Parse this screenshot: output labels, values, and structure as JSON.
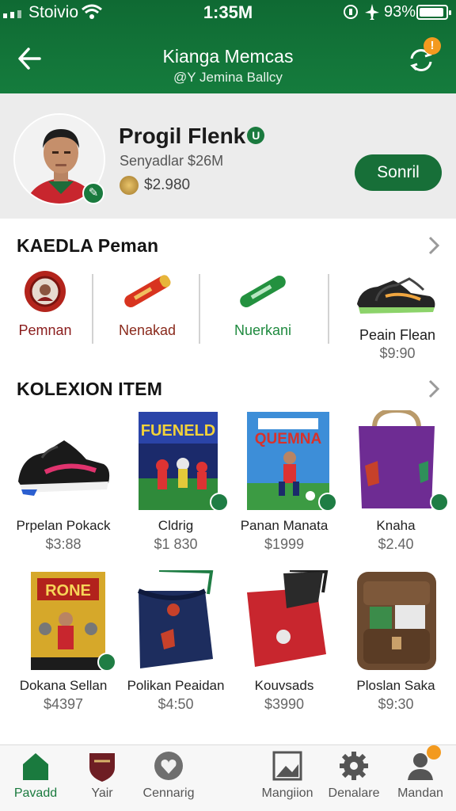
{
  "status_bar": {
    "carrier": "Stoivio",
    "time": "1:35M",
    "battery": "93%",
    "battery_level": 0.93
  },
  "header": {
    "title": "Kianga Memcas",
    "subtitle": "@Y Jemina Ballcy",
    "sync_badge": "!"
  },
  "profile": {
    "name": "Progil Flenk",
    "subtitle": "Senyadlar $26M",
    "balance": "$2.980",
    "follow_label": "Sonril"
  },
  "categories_section": {
    "title": "KAEDLA Peman",
    "items": [
      {
        "label": "Pemnan",
        "price": "",
        "color": "#8a1c1c"
      },
      {
        "label": "Nenakad",
        "price": "",
        "color": "#8a2a1c"
      },
      {
        "label": "Nuerkani",
        "price": "",
        "color": "#1f8a3f"
      },
      {
        "label": "Peain Flean",
        "price": "$9:90",
        "color": "#1c1c1c"
      }
    ]
  },
  "collection_section": {
    "title": "KOLEXION ITEM",
    "items": [
      {
        "name": "Prpelan Pokack",
        "price": "$3:88",
        "icon": "sneaker-icon"
      },
      {
        "name": "Cldrig",
        "price": "$1 830",
        "icon": "game-box-icon",
        "box_text": "FUENELD"
      },
      {
        "name": "Panan Manata",
        "price": "$1999",
        "icon": "game-box-icon",
        "box_text": "QUEMNA"
      },
      {
        "name": "Knaha",
        "price": "$2.40",
        "icon": "tote-bag-icon"
      },
      {
        "name": "Dokana Sellan",
        "price": "$4397",
        "icon": "game-box-icon",
        "box_text": "RONE"
      },
      {
        "name": "Polikan Peaidan",
        "price": "$4:50",
        "icon": "drawstring-bag-icon"
      },
      {
        "name": "Kouvsads",
        "price": "$3990",
        "icon": "drawstring-bag-icon"
      },
      {
        "name": "Ploslan Saka",
        "price": "$9:30",
        "icon": "backpack-icon"
      }
    ]
  },
  "bottom_nav": {
    "items": [
      {
        "label": "Pavadd",
        "icon": "home-icon",
        "active": true
      },
      {
        "label": "Yair",
        "icon": "shield-icon",
        "active": false
      },
      {
        "label": "Cennarig",
        "icon": "heart-icon",
        "active": false
      },
      {
        "label": "Mangiion",
        "icon": "frame-icon",
        "active": false
      },
      {
        "label": "Denalare",
        "icon": "gear-icon",
        "active": false
      },
      {
        "label": "Mandan",
        "icon": "person-icon",
        "active": false
      }
    ]
  }
}
